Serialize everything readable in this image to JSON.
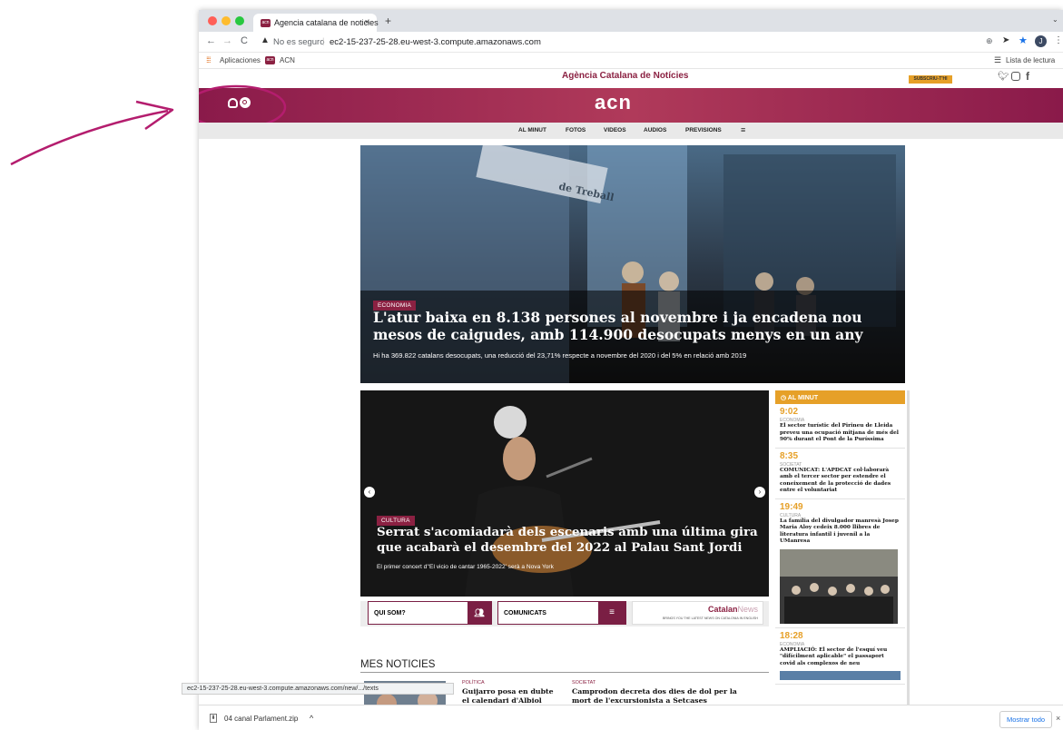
{
  "browser": {
    "tab_title": "Agencia catalana de noticies",
    "address_security": "No es seguro",
    "address_url": "ec2-15-237-25-28.eu-west-3.compute.amazonaws.com",
    "bookmarks": [
      "Aplicaciones",
      "ACN"
    ],
    "reading_list": "Lista de lectura",
    "profile_initial": "J",
    "status_url": "ec2-15-237-25-28.eu-west-3.compute.amazonaws.com/new/.../texts",
    "download_file": "04 canal Parlament.zip",
    "download_show_all": "Mostrar todo"
  },
  "site": {
    "masthead": "Agència Catalana de Notícies",
    "subscribe": "SUBSCRIU-T'HI",
    "logo": "acn",
    "nav": [
      "AL MINUT",
      "FOTOS",
      "VIDEOS",
      "AUDIOS",
      "PREVISIONS"
    ],
    "hero": {
      "category": "ECONOMIA",
      "headline": "L'atur baixa en 8.138 persones al novembre i ja encadena nou mesos de caigudes, amb 114.900 desocupats menys en un any",
      "summary": "Hi ha 369.822 catalans desocupats, una reducció del 23,71% respecte a novembre del 2020 i del 5% en relació amb 2019",
      "sign_text": "de Treball"
    },
    "carousel": {
      "category": "CULTURA",
      "headline": "Serrat s'acomiadarà dels escenaris amb una última gira que acabarà el desembre del 2022 al Palau Sant Jordi",
      "summary": "El primer concert d'‘El vicio de cantar 1965-2022’ serà a Nova York"
    },
    "al_minut": {
      "title": "AL MINUT",
      "items": [
        {
          "time": "9:02",
          "cat": "ECONOMIA",
          "text": "El sector turístic del Pirineu de Lleida preveu una ocupació mitjana de més del 90% durant el Pont de la Puríssima"
        },
        {
          "time": "8:35",
          "cat": "SOCIETAT",
          "text": "COMUNICAT: L'APDCAT col·laborarà amb el tercer sector per estendre el coneixement de la protecció de dades entre el voluntariat"
        },
        {
          "time": "19:49",
          "cat": "CULTURA",
          "text": "La família del divulgador manresà Josep Maria Aloy cedeix 8.000 llibres de literatura infantil i juvenil a la UManresa"
        },
        {
          "time": "18:28",
          "cat": "ECONOMIA",
          "text": "AMPLIACIÓ: El sector de l'esquí veu \"difícilment aplicable\" el passaport covid als complexos de neu"
        }
      ]
    },
    "promos": {
      "qui_som": "QUI SOM?",
      "comunicats": "COMUNICATS",
      "catalan": "Catalan",
      "news": "News",
      "catalan_sub": "BRINGS YOU THE LATEST NEWS ON CATALONIA IN ENGLISH"
    },
    "mes_noticies": {
      "title": "MÉS NOTÍCIES",
      "items": [
        {
          "cat": "POLÍTICA",
          "text": "Guijarro posa en dubte el calendari d'Albiol sobre el port: \"Ni tan sols"
        },
        {
          "cat": "SOCIETAT",
          "text": "Camprodon decreta dos dies de dol per la mort de l'excursionista a Setcases"
        }
      ]
    }
  },
  "colors": {
    "brand": "#8b2142",
    "accent": "#e6a028"
  }
}
